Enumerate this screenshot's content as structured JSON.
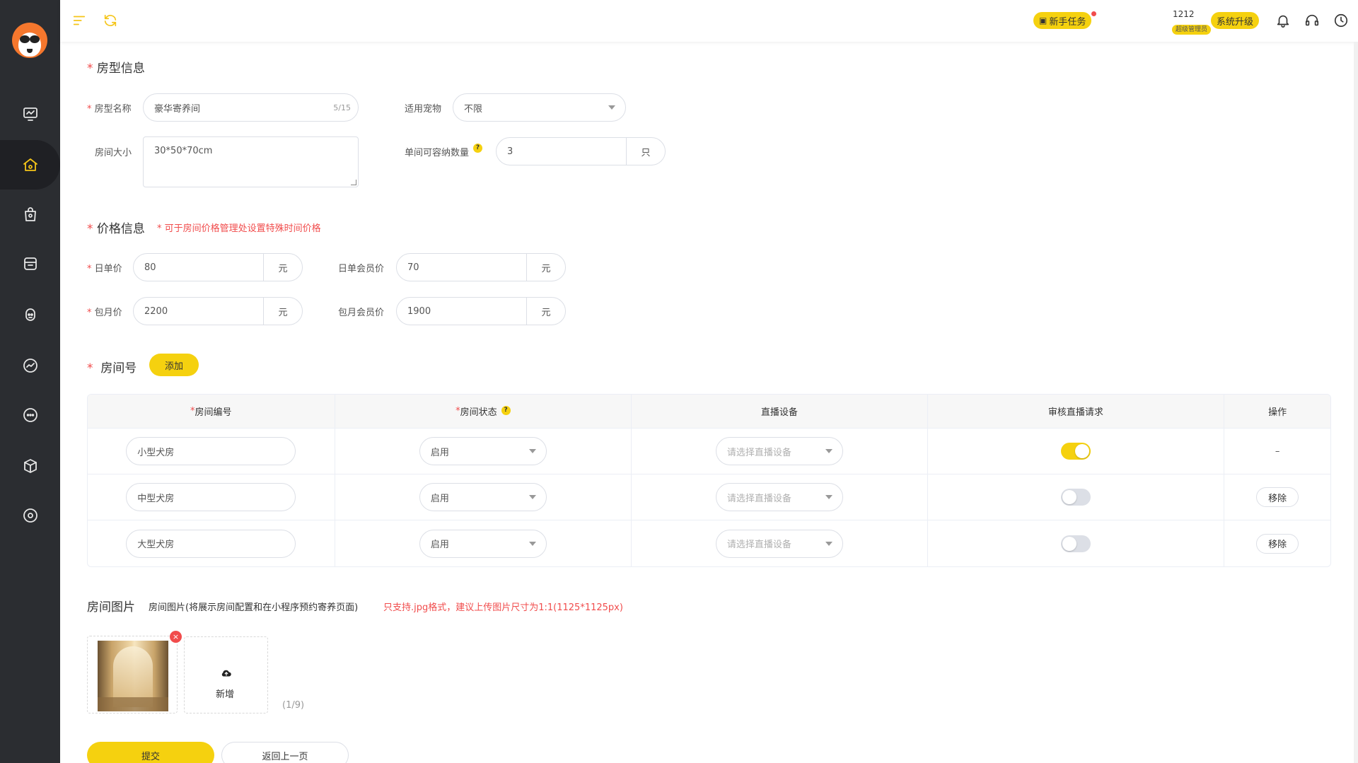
{
  "topbar": {
    "new_task_label": "新手任务",
    "user_id": "1212",
    "user_role": "超级管理员",
    "upgrade_label": "系统升级"
  },
  "sections": {
    "room_type_info": "房型信息",
    "price_info": "价格信息",
    "price_note": "* 可于房间价格管理处设置特殊时间价格",
    "room_numbers": "房间号",
    "room_images": "房间图片",
    "images_desc": "房间图片(将展示房间配置和在小程序预约寄养页面)",
    "images_note": "只支持.jpg格式，建议上传图片尺寸为1:1(1125*1125px)"
  },
  "form": {
    "room_name_label": "房型名称",
    "room_name_value": "豪华寄养间",
    "room_name_counter": "5/15",
    "pet_label": "适用宠物",
    "pet_value": "不限",
    "room_size_label": "房间大小",
    "room_size_value": "30*50*70cm",
    "capacity_label": "单间可容纳数量",
    "capacity_value": "3",
    "capacity_unit": "只",
    "daily_price_label": "日单价",
    "daily_price_value": "80",
    "daily_member_label": "日单会员价",
    "daily_member_value": "70",
    "monthly_price_label": "包月价",
    "monthly_price_value": "2200",
    "monthly_member_label": "包月会员价",
    "monthly_member_value": "1900",
    "currency_unit": "元",
    "help_symbol": "?"
  },
  "rooms": {
    "add_label": "添加",
    "headers": {
      "number": "房间编号",
      "status": "房间状态",
      "device": "直播设备",
      "review": "审核直播请求",
      "action": "操作"
    },
    "device_placeholder": "请选择直播设备",
    "remove_label": "移除",
    "rows": [
      {
        "name": "小型犬房",
        "status": "启用",
        "review_on": true,
        "action": "–"
      },
      {
        "name": "中型犬房",
        "status": "启用",
        "review_on": false,
        "action": "移除"
      },
      {
        "name": "大型犬房",
        "status": "启用",
        "review_on": false,
        "action": "移除"
      }
    ]
  },
  "images": {
    "add_label": "新增",
    "count": "(1/9)",
    "delete_symbol": "×"
  },
  "footer": {
    "submit_label": "提交",
    "back_label": "返回上一页"
  },
  "colors": {
    "accent": "#f5d10f",
    "sidebar_bg": "#2b2d31",
    "required": "#f14c4c"
  }
}
